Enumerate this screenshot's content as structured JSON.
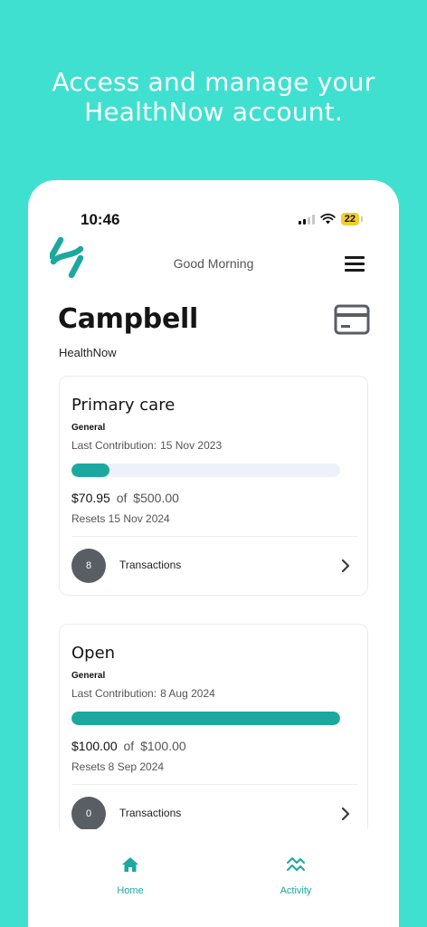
{
  "headline": {
    "line1": "Access and manage your",
    "line2": "HealthNow account."
  },
  "status_bar": {
    "time": "10:46",
    "battery": "22"
  },
  "header": {
    "greeting": "Good Morning",
    "logo_icon": "healthnow-logo-icon",
    "menu_icon": "hamburger-menu-icon"
  },
  "member": {
    "name": "Campbell",
    "provider": "HealthNow",
    "card_icon": "membership-card-icon"
  },
  "accounts": [
    {
      "title": "Primary care",
      "type": "General",
      "last_contribution_label": "Last Contribution:",
      "last_contribution_value": "15 Nov 2023",
      "used": "$70.95",
      "of_label": "of",
      "limit": "$500.00",
      "progress": 0.142,
      "resets": "Resets 15 Nov 2024",
      "transactions_count": "8",
      "transactions_label": "Transactions"
    },
    {
      "title": "Open",
      "type": "General",
      "last_contribution_label": "Last Contribution:",
      "last_contribution_value": "8 Aug 2024",
      "used": "$100.00",
      "of_label": "of",
      "limit": "$100.00",
      "progress": 1.0,
      "resets": "Resets 8 Sep 2024",
      "transactions_count": "0",
      "transactions_label": "Transactions"
    }
  ],
  "nav": {
    "home": "Home",
    "activity": "Activity"
  },
  "colors": {
    "background": "#40e0d0",
    "accent": "#1ca89f",
    "badge": "#595e64",
    "battery": "#f5cc2d"
  }
}
